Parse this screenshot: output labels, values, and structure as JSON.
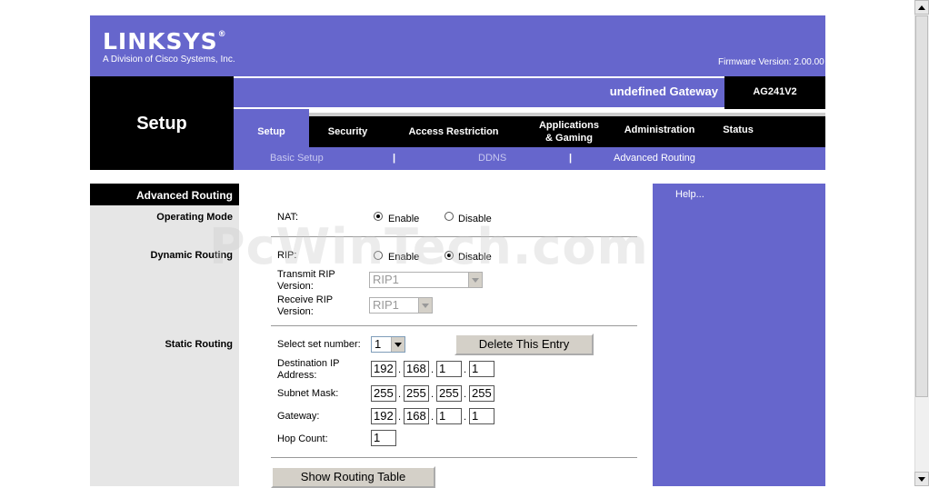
{
  "header": {
    "brand": "LINKSYS",
    "brand_mark": "®",
    "brand_sub": "A Division of Cisco Systems, Inc.",
    "firmware": "Firmware Version: 2.00.00",
    "gateway_name": "undefined Gateway",
    "model": "AG241V2",
    "section": "Setup"
  },
  "tabs": [
    {
      "label": "Setup"
    },
    {
      "label": "Security"
    },
    {
      "label": "Access Restriction"
    },
    {
      "label": "Applications\n& Gaming"
    },
    {
      "label": "Administration"
    },
    {
      "label": "Status"
    }
  ],
  "subtabs": {
    "basic": "Basic Setup",
    "ddns": "DDNS",
    "advanced": "Advanced Routing",
    "sep": "|"
  },
  "left": {
    "section_title": "Advanced Routing",
    "operating_mode": "Operating Mode",
    "dynamic_routing": "Dynamic Routing",
    "static_routing": "Static Routing"
  },
  "help": "Help...",
  "nat": {
    "label": "NAT:",
    "enable": "Enable",
    "disable": "Disable",
    "selected": "enable"
  },
  "rip": {
    "label": "RIP:",
    "enable": "Enable",
    "disable": "Disable",
    "selected": "disable",
    "transmit_label_1": "Transmit RIP",
    "transmit_label_2": "Version:",
    "transmit_value": "RIP1",
    "receive_label_1": "Receive RIP",
    "receive_label_2": "Version:",
    "receive_value": "RIP1"
  },
  "static": {
    "select_label": "Select set number:",
    "select_value": "1",
    "delete_button": "Delete This Entry",
    "dest_label_1": "Destination IP",
    "dest_label_2": "Address:",
    "dest_ip": [
      "192",
      "168",
      "1",
      "1"
    ],
    "mask_label": "Subnet Mask:",
    "mask": [
      "255",
      "255",
      "255",
      "255"
    ],
    "gateway_label": "Gateway:",
    "gateway": [
      "192",
      "168",
      "1",
      "1"
    ],
    "hop_label": "Hop Count:",
    "hop_value": "1",
    "show_table_button": "Show Routing Table"
  },
  "watermark": "PcWinTech.com",
  "colors": {
    "brand_purple": "#6666cc",
    "black": "#000000",
    "left_gray": "#e6e6e6"
  }
}
